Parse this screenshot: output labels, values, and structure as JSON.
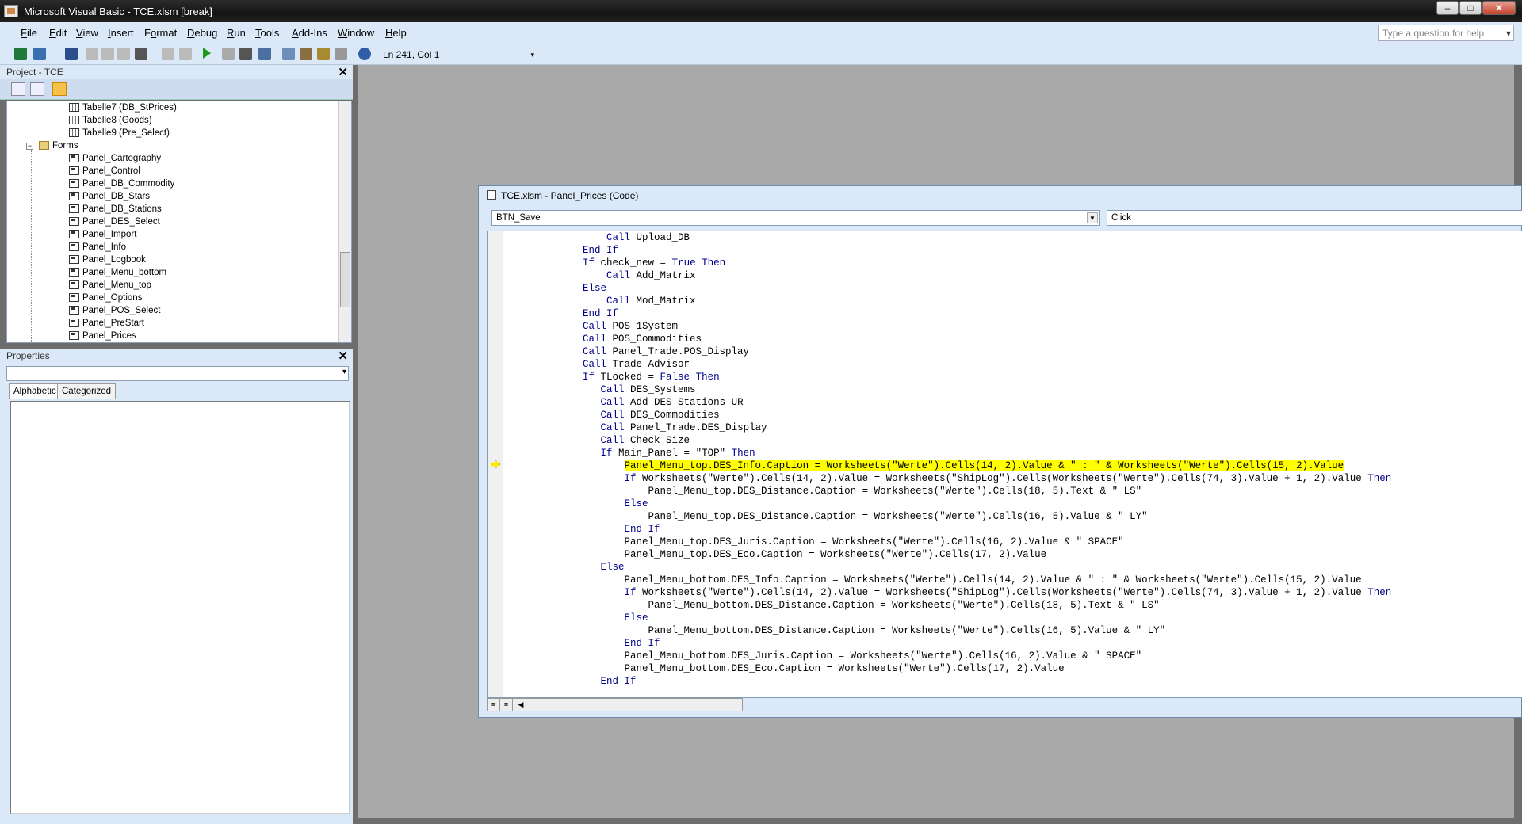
{
  "window": {
    "title": "Microsoft Visual Basic - TCE.xlsm [break]"
  },
  "menu": [
    {
      "pre": "",
      "u": "F",
      "post": "ile"
    },
    {
      "pre": "",
      "u": "E",
      "post": "dit"
    },
    {
      "pre": "",
      "u": "V",
      "post": "iew"
    },
    {
      "pre": "",
      "u": "I",
      "post": "nsert"
    },
    {
      "pre": "F",
      "u": "o",
      "post": "rmat"
    },
    {
      "pre": "",
      "u": "D",
      "post": "ebug"
    },
    {
      "pre": "",
      "u": "R",
      "post": "un"
    },
    {
      "pre": "",
      "u": "T",
      "post": "ools"
    },
    {
      "pre": "",
      "u": "A",
      "post": "dd-Ins"
    },
    {
      "pre": "",
      "u": "W",
      "post": "indow"
    },
    {
      "pre": "",
      "u": "H",
      "post": "elp"
    }
  ],
  "ask": {
    "placeholder": "Type a question for help"
  },
  "toolbar": {
    "position": "Ln 241, Col 1"
  },
  "project": {
    "title": "Project - TCE",
    "items": [
      {
        "label": "Tabelle7 (DB_StPrices)",
        "type": "sheet"
      },
      {
        "label": "Tabelle8 (Goods)",
        "type": "sheet"
      },
      {
        "label": "Tabelle9 (Pre_Select)",
        "type": "sheet"
      },
      {
        "label": "Forms",
        "type": "folder"
      },
      {
        "label": "Panel_Cartography",
        "type": "form"
      },
      {
        "label": "Panel_Control",
        "type": "form"
      },
      {
        "label": "Panel_DB_Commodity",
        "type": "form"
      },
      {
        "label": "Panel_DB_Stars",
        "type": "form"
      },
      {
        "label": "Panel_DB_Stations",
        "type": "form"
      },
      {
        "label": "Panel_DES_Select",
        "type": "form"
      },
      {
        "label": "Panel_Import",
        "type": "form"
      },
      {
        "label": "Panel_Info",
        "type": "form"
      },
      {
        "label": "Panel_Logbook",
        "type": "form"
      },
      {
        "label": "Panel_Menu_bottom",
        "type": "form"
      },
      {
        "label": "Panel_Menu_top",
        "type": "form"
      },
      {
        "label": "Panel_Options",
        "type": "form"
      },
      {
        "label": "Panel_POS_Select",
        "type": "form"
      },
      {
        "label": "Panel_PreStart",
        "type": "form"
      },
      {
        "label": "Panel_Prices",
        "type": "form"
      }
    ]
  },
  "properties": {
    "title": "Properties",
    "tab_alpha": "Alphabetic",
    "tab_cat": "Categorized"
  },
  "code": {
    "title": "TCE.xlsm - Panel_Prices (Code)",
    "object": "BTN_Save",
    "proc": "Click",
    "lines": [
      {
        "i": "                ",
        "t": "Call Upload_DB"
      },
      {
        "i": "            ",
        "t": "End If"
      },
      {
        "i": "            ",
        "t": "If check_new = True Then"
      },
      {
        "i": "                ",
        "t": "Call Add_Matrix"
      },
      {
        "i": "            ",
        "t": "Else"
      },
      {
        "i": "                ",
        "t": "Call Mod_Matrix"
      },
      {
        "i": "            ",
        "t": "End If"
      },
      {
        "i": "            ",
        "t": "Call POS_1System"
      },
      {
        "i": "            ",
        "t": "Call POS_Commodities"
      },
      {
        "i": "            ",
        "t": "Call Panel_Trade.POS_Display"
      },
      {
        "i": "            ",
        "t": "Call Trade_Advisor"
      },
      {
        "i": "            ",
        "t": "If TLocked = False Then"
      },
      {
        "i": "               ",
        "t": "Call DES_Systems"
      },
      {
        "i": "               ",
        "t": "Call Add_DES_Stations_UR"
      },
      {
        "i": "               ",
        "t": "Call DES_Commodities"
      },
      {
        "i": "               ",
        "t": "Call Panel_Trade.DES_Display"
      },
      {
        "i": "               ",
        "t": "Call Check_Size"
      },
      {
        "i": "               ",
        "t": "If Main_Panel = \"TOP\" Then"
      },
      {
        "i": "                   ",
        "t": "Panel_Menu_top.DES_Info.Caption = Worksheets(\"Werte\").Cells(14, 2).Value & \" : \" & Worksheets(\"Werte\").Cells(15, 2).Value",
        "hl": true
      },
      {
        "i": "                   ",
        "t": "If Worksheets(\"Werte\").Cells(14, 2).Value = Worksheets(\"ShipLog\").Cells(Worksheets(\"Werte\").Cells(74, 3).Value + 1, 2).Value Then"
      },
      {
        "i": "                       ",
        "t": "Panel_Menu_top.DES_Distance.Caption = Worksheets(\"Werte\").Cells(18, 5).Text & \" LS\""
      },
      {
        "i": "                   ",
        "t": "Else"
      },
      {
        "i": "                       ",
        "t": "Panel_Menu_top.DES_Distance.Caption = Worksheets(\"Werte\").Cells(16, 5).Value & \" LY\""
      },
      {
        "i": "                   ",
        "t": "End If"
      },
      {
        "i": "                   ",
        "t": "Panel_Menu_top.DES_Juris.Caption = Worksheets(\"Werte\").Cells(16, 2).Value & \" SPACE\""
      },
      {
        "i": "                   ",
        "t": "Panel_Menu_top.DES_Eco.Caption = Worksheets(\"Werte\").Cells(17, 2).Value"
      },
      {
        "i": "               ",
        "t": "Else"
      },
      {
        "i": "                   ",
        "t": "Panel_Menu_bottom.DES_Info.Caption = Worksheets(\"Werte\").Cells(14, 2).Value & \" : \" & Worksheets(\"Werte\").Cells(15, 2).Value"
      },
      {
        "i": "                   ",
        "t": "If Worksheets(\"Werte\").Cells(14, 2).Value = Worksheets(\"ShipLog\").Cells(Worksheets(\"Werte\").Cells(74, 3).Value + 1, 2).Value Then"
      },
      {
        "i": "                       ",
        "t": "Panel_Menu_bottom.DES_Distance.Caption = Worksheets(\"Werte\").Cells(18, 5).Text & \" LS\""
      },
      {
        "i": "                   ",
        "t": "Else"
      },
      {
        "i": "                       ",
        "t": "Panel_Menu_bottom.DES_Distance.Caption = Worksheets(\"Werte\").Cells(16, 5).Value & \" LY\""
      },
      {
        "i": "                   ",
        "t": "End If"
      },
      {
        "i": "                   ",
        "t": "Panel_Menu_bottom.DES_Juris.Caption = Worksheets(\"Werte\").Cells(16, 2).Value & \" SPACE\""
      },
      {
        "i": "                   ",
        "t": "Panel_Menu_bottom.DES_Eco.Caption = Worksheets(\"Werte\").Cells(17, 2).Value"
      },
      {
        "i": "               ",
        "t": "End If"
      }
    ]
  },
  "colors": {
    "keyword": "#00008b",
    "highlight": "#ffff00",
    "chrome": "#dbe8f7"
  }
}
